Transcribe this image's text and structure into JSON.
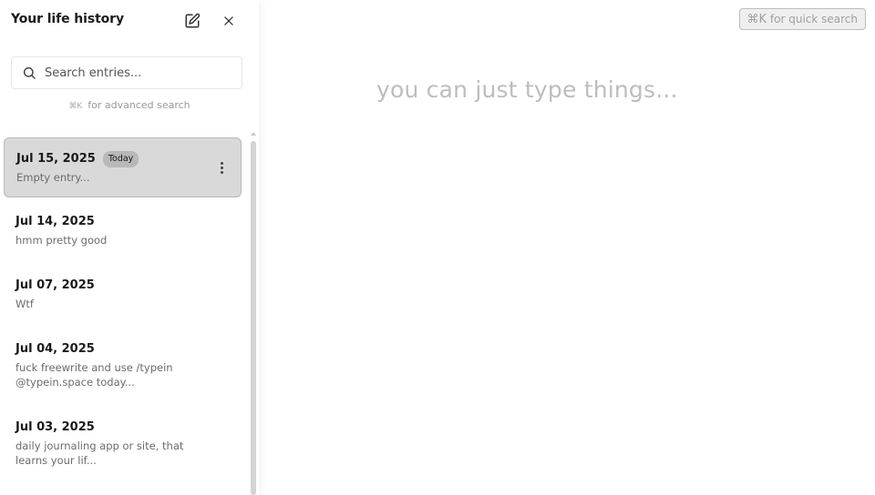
{
  "sidebar": {
    "title": "Your life history",
    "search": {
      "placeholder": "Search entries...",
      "value": ""
    },
    "advanced_hint": {
      "shortcut": "⌘K",
      "text": "for advanced search"
    },
    "entries": [
      {
        "date": "Jul 15, 2025",
        "badge": "Today",
        "snippet": "Empty entry..."
      },
      {
        "date": "Jul 14, 2025",
        "snippet": "hmm pretty good"
      },
      {
        "date": "Jul 07, 2025",
        "snippet": "Wtf"
      },
      {
        "date": "Jul 04, 2025",
        "snippet": "fuck freewrite and use /typein @typein.space today..."
      },
      {
        "date": "Jul 03, 2025",
        "snippet": "daily journaling app or site, that learns your lif..."
      }
    ],
    "icons": {
      "edit": "edit-icon",
      "close": "close-icon",
      "search": "search-icon",
      "more": "more-vertical-icon"
    }
  },
  "main": {
    "quick_search": {
      "shortcut": "⌘K",
      "text": "for quick search"
    },
    "editor_placeholder": "you can just type things..."
  },
  "colors": {
    "active_entry_bg": "#d9d9d9",
    "badge_bg": "#b8b8b8",
    "placeholder_text": "#bdbdbd",
    "muted_text": "#6b6b6b"
  }
}
